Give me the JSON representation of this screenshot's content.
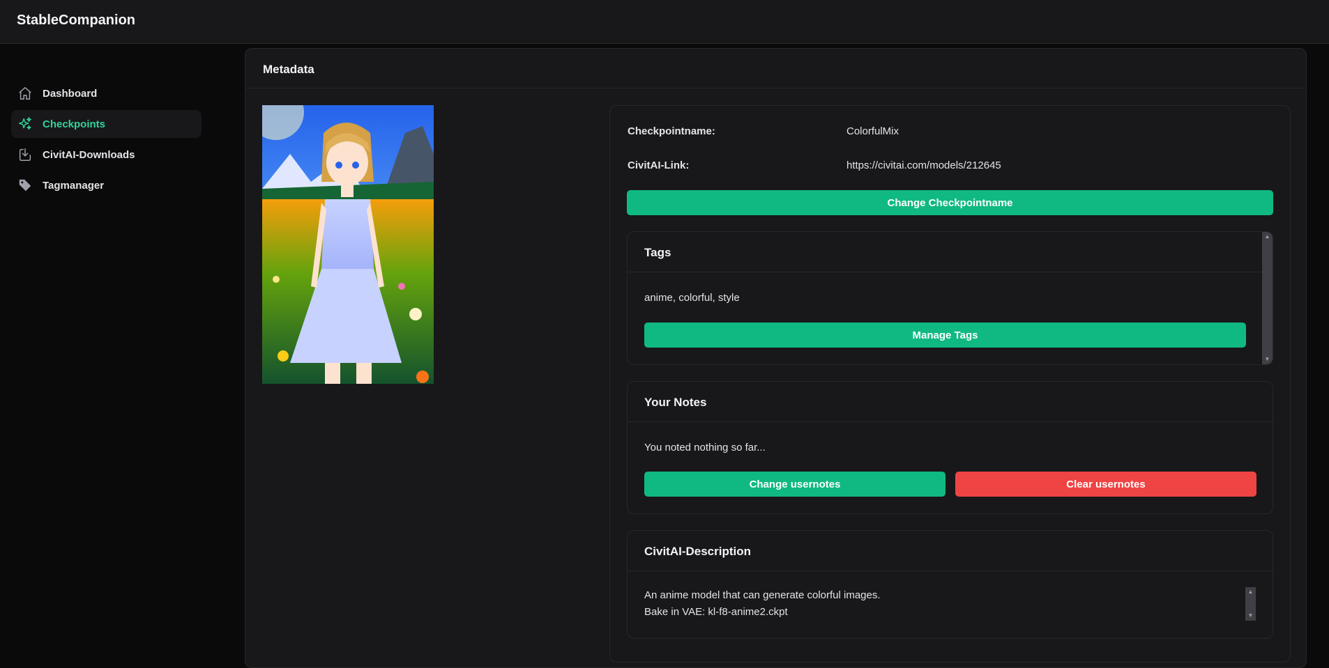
{
  "app": {
    "title": "StableCompanion"
  },
  "sidebar": {
    "items": [
      {
        "label": "Dashboard",
        "icon": "home-icon",
        "active": false
      },
      {
        "label": "Checkpoints",
        "icon": "sparkles-icon",
        "active": true
      },
      {
        "label": "CivitAI-Downloads",
        "icon": "download-icon",
        "active": false
      },
      {
        "label": "Tagmanager",
        "icon": "tag-icon",
        "active": false
      }
    ]
  },
  "main": {
    "title": "Metadata",
    "preview_image": {
      "description_icon": "model-preview-image"
    },
    "details": {
      "checkpoint_label": "Checkpointname:",
      "checkpoint_value": "ColorfulMix",
      "link_label": "CivitAI-Link:",
      "link_value": "https://civitai.com/models/212645",
      "change_name_button": "Change Checkpointname"
    },
    "tags": {
      "title": "Tags",
      "value": "anime, colorful, style",
      "manage_button": "Manage Tags"
    },
    "notes": {
      "title": "Your Notes",
      "value": "You noted nothing so far...",
      "change_button": "Change usernotes",
      "clear_button": "Clear usernotes"
    },
    "description": {
      "title": "CivitAI-Description",
      "line1": "An anime model that can generate colorful images.",
      "line2": "Bake in VAE: kl-f8-anime2.ckpt"
    }
  },
  "colors": {
    "accent": "#10b981",
    "danger": "#ef4444",
    "active_text": "#34d399",
    "background": "#0a0a0b",
    "card": "#18181b"
  }
}
